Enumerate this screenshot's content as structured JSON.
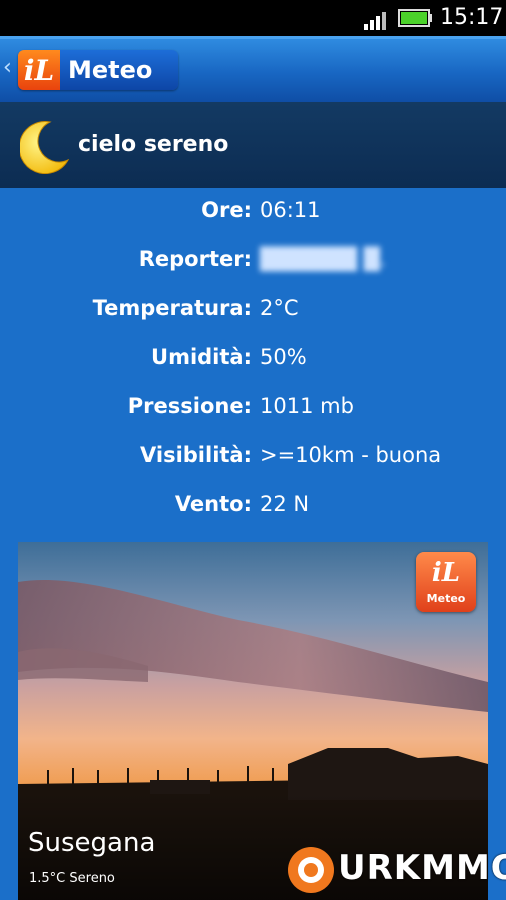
{
  "status_bar": {
    "time": "15:17"
  },
  "app_bar": {
    "logo_il": "iL",
    "logo_meteo": "Meteo"
  },
  "condition": {
    "text": "cielo sereno",
    "icon": "moon-icon"
  },
  "details": [
    {
      "label": "Ore:",
      "value": "06:11"
    },
    {
      "label": "Reporter:",
      "value": "██████ █."
    },
    {
      "label": "Temperatura:",
      "value": "2°C"
    },
    {
      "label": "Umidità:",
      "value": "50%"
    },
    {
      "label": "Pressione:",
      "value": "1011 mb"
    },
    {
      "label": "Visibilità:",
      "value": ">=10km - buona"
    },
    {
      "label": "Vento:",
      "value": "22 N"
    }
  ],
  "photo": {
    "logo_il": "iL",
    "logo_meteo": "Meteo",
    "location": "Susegana",
    "caption": "1.5°C Sereno"
  },
  "watermark": {
    "text": "URKMMO"
  },
  "colors": {
    "background": "#1b6fc9",
    "header": "#0c2c52",
    "logo_orange": "#e9430d"
  }
}
